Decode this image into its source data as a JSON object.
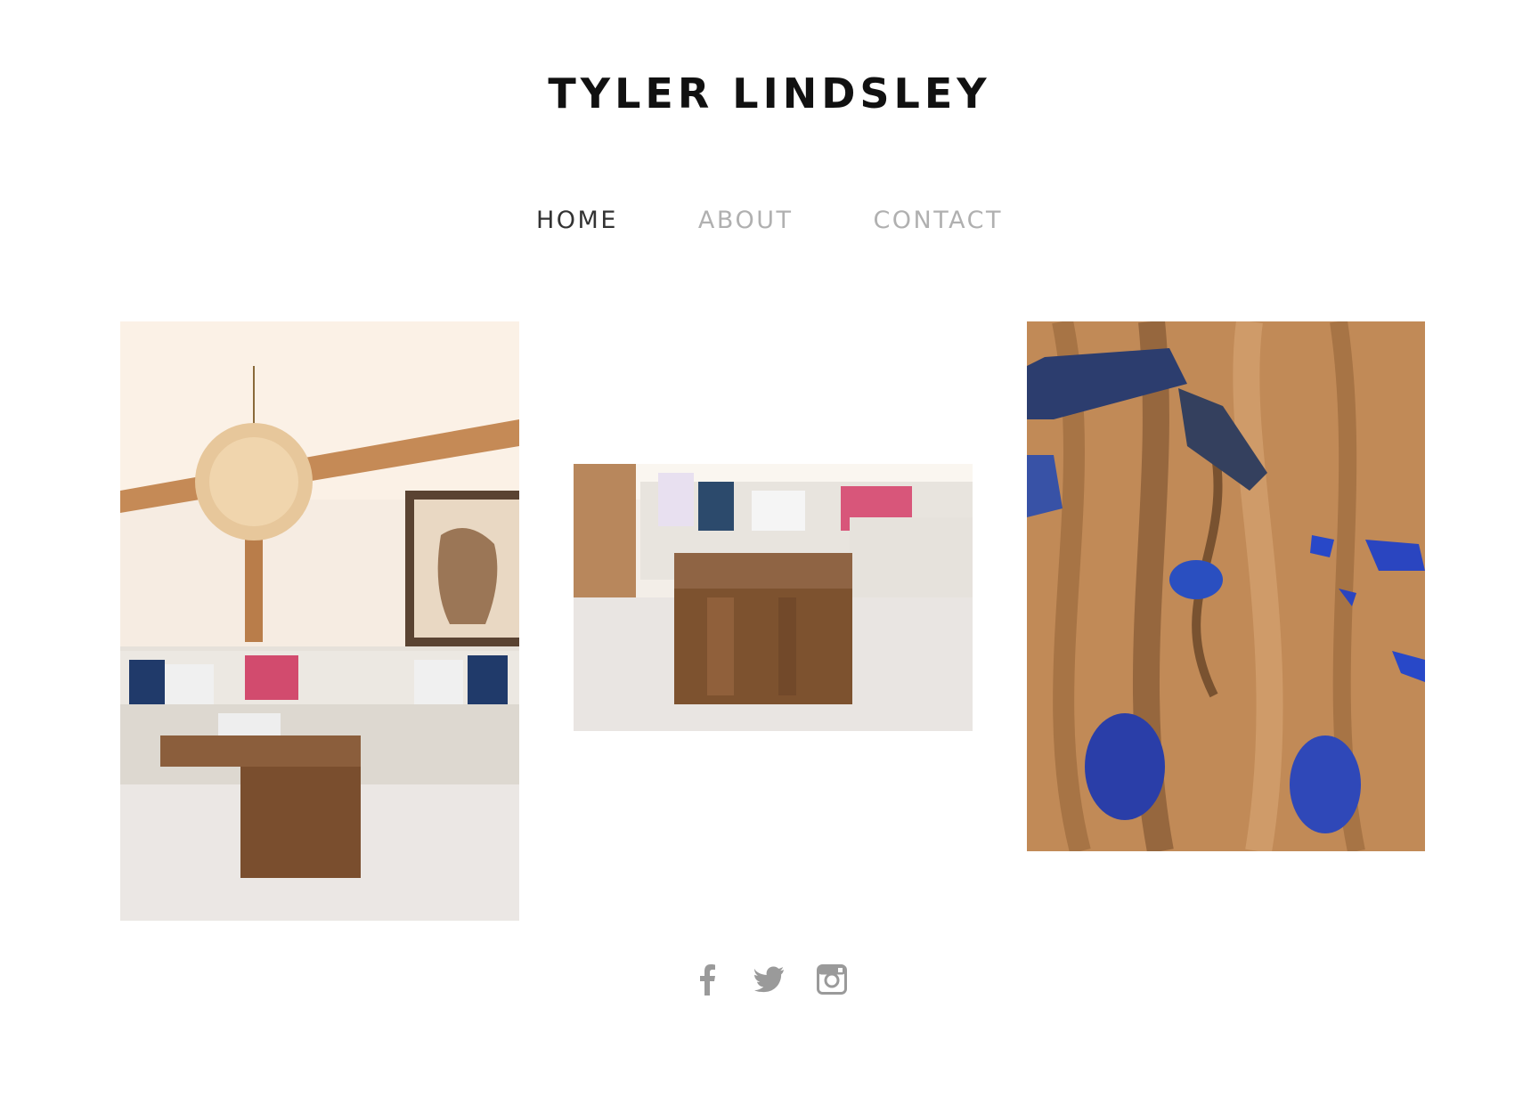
{
  "header": {
    "title": "TYLER LINDSLEY"
  },
  "nav": {
    "items": [
      {
        "label": "HOME",
        "active": true
      },
      {
        "label": "ABOUT",
        "active": false
      },
      {
        "label": "CONTACT",
        "active": false
      }
    ]
  },
  "gallery": [
    {
      "icon": "photo-living-room-chandelier"
    },
    {
      "icon": "photo-coffee-table-sectional"
    },
    {
      "icon": "photo-wood-slab-lapis"
    }
  ],
  "footer": {
    "social": [
      {
        "icon": "facebook-icon"
      },
      {
        "icon": "twitter-icon"
      },
      {
        "icon": "instagram-icon"
      }
    ],
    "icon_color": "#9a9a9a"
  },
  "colors": {
    "title": "#111111",
    "nav_active": "#333333",
    "nav_inactive": "#b0b0b0"
  }
}
